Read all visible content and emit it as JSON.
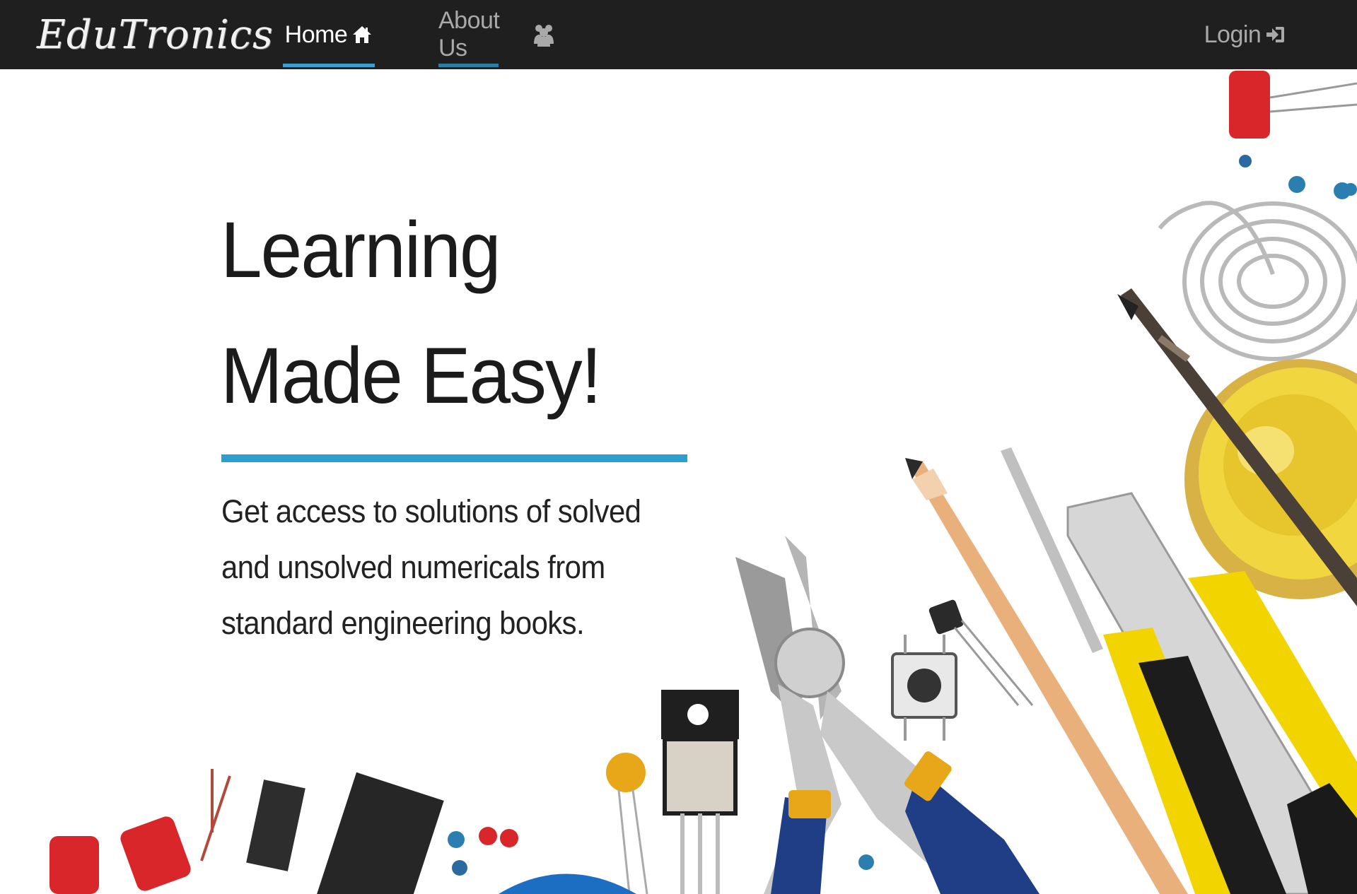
{
  "nav": {
    "brand": "EduTronics",
    "home_label": "Home",
    "home_icon": "home-icon",
    "about_label": "About Us",
    "about_icon": "users-icon",
    "login_label": "Login",
    "login_icon": "sign-in-icon",
    "active_tab": "Home"
  },
  "hero": {
    "headline_line1": "Learning",
    "headline_line2": "Made Easy!",
    "subtitle": "Get access to solutions of solved and unsolved numericals from standard engineering books."
  },
  "colors": {
    "navbar_bg": "#1f1f1f",
    "accent": "#2a9fd0",
    "inactive_nav_text": "#a9a9a9"
  }
}
